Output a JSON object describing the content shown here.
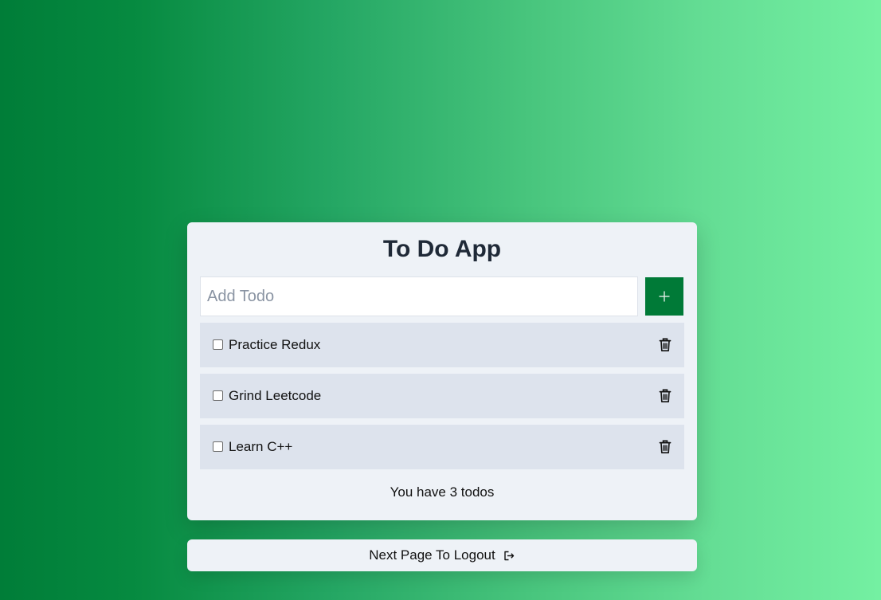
{
  "app": {
    "title": "To Do App"
  },
  "add_form": {
    "placeholder": "Add Todo",
    "value": "",
    "add_button_icon": "plus-icon"
  },
  "todos": [
    {
      "text": "Practice Redux",
      "checked": false
    },
    {
      "text": "Grind Leetcode",
      "checked": false
    },
    {
      "text": "Learn C++",
      "checked": false
    }
  ],
  "footer": {
    "count_text": "You have 3 todos"
  },
  "logout": {
    "label": "Next Page To Logout",
    "icon": "logout-icon"
  },
  "colors": {
    "accent": "#007a37",
    "card_background": "#eef2f7",
    "row_background": "#dde3ed",
    "gradient_start": "#007d38",
    "gradient_end": "#74f0a2"
  }
}
